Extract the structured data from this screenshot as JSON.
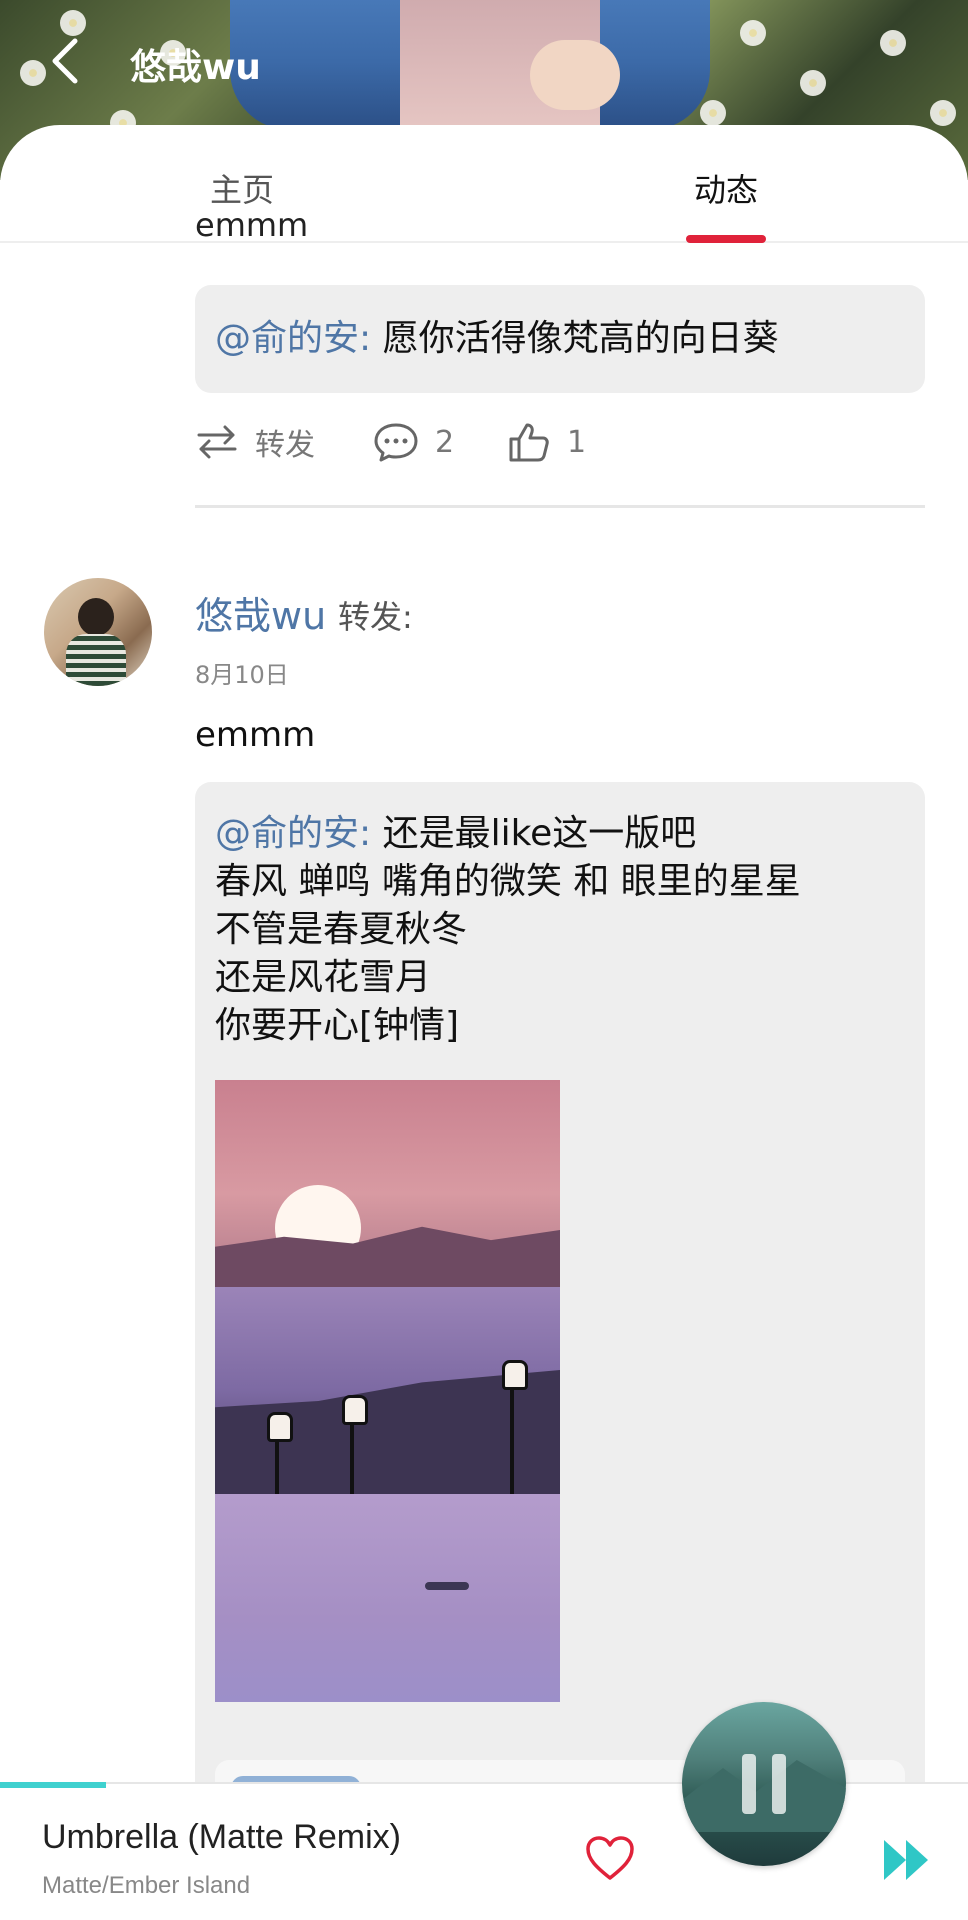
{
  "header": {
    "title": "悠哉wu",
    "back_icon": "chevron-left-icon"
  },
  "tabs": [
    {
      "label": "主页",
      "active": false
    },
    {
      "label": "动态",
      "active": true
    }
  ],
  "colors": {
    "accent": "#e0223a",
    "mention": "#4f76a6",
    "progress": "#3fd1cf"
  },
  "feed": {
    "prev_post": {
      "clipped_text": "emmm",
      "quote": {
        "mention": "@俞的安:",
        "text": " 愿你活得像梵高的向日葵"
      },
      "actions": {
        "forward_label": "转发",
        "comment_count": "2",
        "like_count": "1"
      }
    },
    "post": {
      "author": "悠哉wu",
      "action": "转发:",
      "date": "8月10日",
      "body": "emmm",
      "quote": {
        "mention": "@俞的安:",
        "lines": [
          " 还是最like这一版吧",
          "春风 蝉鸣 嘴角的微笑 和 眼里的星星",
          "不管是春夏秋冬",
          "还是风花雪月",
          "你要开心[钟情]"
        ]
      }
    }
  },
  "player": {
    "song_title": "Umbrella (Matte Remix)",
    "artist": "Matte/Ember Island",
    "progress": 0.11,
    "is_playing": true
  }
}
